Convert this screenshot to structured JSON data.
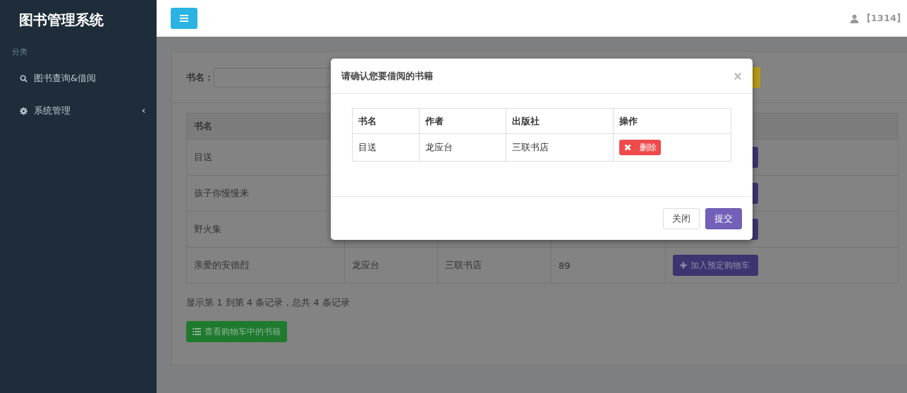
{
  "sidebar": {
    "title": "图书管理系统",
    "section": "分类",
    "items": [
      {
        "label": "图书查询&借阅",
        "kind": "search",
        "expandable": false
      },
      {
        "label": "系统管理",
        "kind": "settings",
        "expandable": true
      }
    ]
  },
  "header": {
    "user": "【1314】"
  },
  "search": {
    "label": "书名："
  },
  "table": {
    "columns": [
      "书名"
    ],
    "rows": [
      {
        "title": "目送"
      },
      {
        "title": "孩子你慢慢来"
      },
      {
        "title": "野火集"
      },
      {
        "title": "亲爱的安德烈",
        "author": "龙应台",
        "publisher": "三联书店",
        "price": "89",
        "action": "加入预定购物车"
      }
    ]
  },
  "summary": "显示第 1 到第 4 条记录，总共 4 条记录",
  "cart_button": "查看购物车中的书籍",
  "modal": {
    "title": "请确认您要借阅的书籍",
    "close": "×",
    "columns": [
      "书名",
      "作者",
      "出版社",
      "操作"
    ],
    "rows": [
      {
        "title": "目送",
        "author": "龙应台",
        "publisher": "三联书店",
        "action": "删除"
      }
    ],
    "buttons": [
      {
        "label": "关闭",
        "kind": "default"
      },
      {
        "label": "提交",
        "kind": "primary"
      }
    ]
  }
}
